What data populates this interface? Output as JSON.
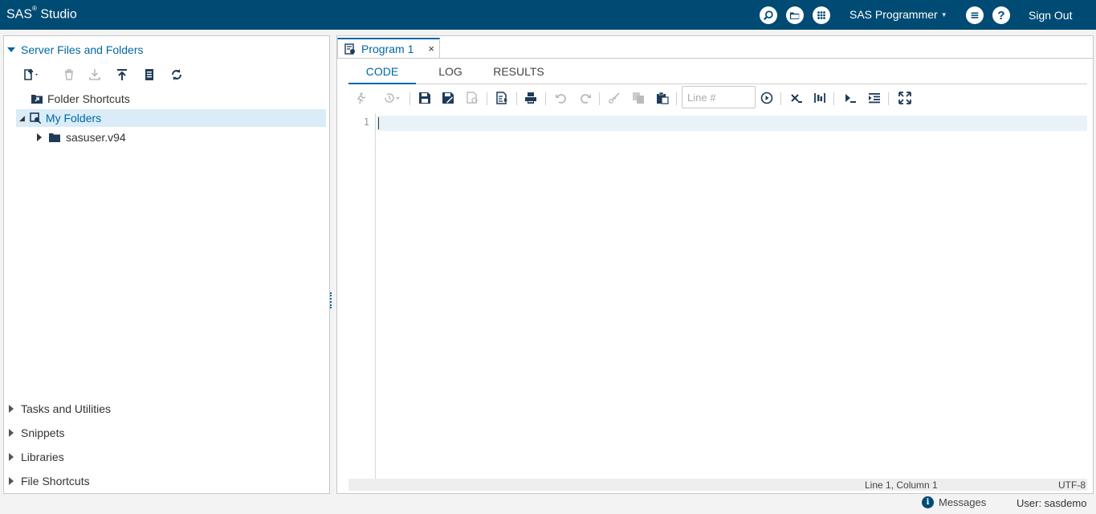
{
  "app": {
    "title": "SAS",
    "title_sup": "®",
    "title_suffix": " Studio",
    "perspective": "SAS Programmer",
    "signout_label": "Sign Out",
    "top_icons": [
      "search-icon",
      "open-folder-icon",
      "apps-grid-icon",
      "menu-list-icon",
      "help-icon"
    ]
  },
  "navigation": {
    "section_title": "Server Files and Folders",
    "toolbar_icons": [
      "new-item-icon",
      "delete-icon",
      "download-icon",
      "upload-icon",
      "properties-icon",
      "refresh-icon"
    ],
    "tree": [
      {
        "label": "Folder Shortcuts"
      },
      {
        "label": "My Folders"
      },
      {
        "label": "sasuser.v94"
      }
    ],
    "collapsed_sections": [
      "Tasks and Utilities",
      "Snippets",
      "Libraries",
      "File Shortcuts"
    ]
  },
  "editor": {
    "tab_label": "Program 1",
    "tab_close": "×",
    "subtabs": [
      "CODE",
      "LOG",
      "RESULTS"
    ],
    "active_subtab": "CODE",
    "line_placeholder": "Line #",
    "line_number": "1",
    "status_position": "Line 1, Column 1",
    "status_encoding": "UTF-8"
  },
  "footer": {
    "messages_label": "Messages",
    "user_label": "User: sasdemo"
  },
  "colors": {
    "topbar": "#004b73",
    "accent": "#0067a3",
    "selection": "#d9ecf8"
  }
}
